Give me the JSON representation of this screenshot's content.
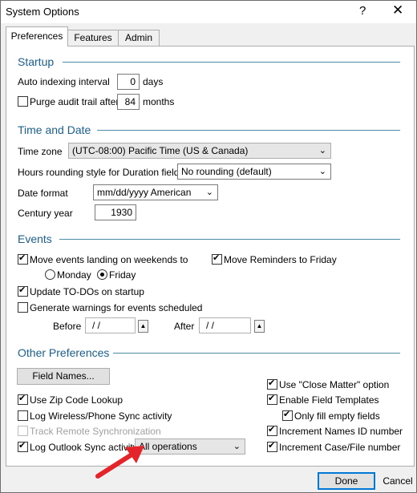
{
  "window": {
    "title": "System Options",
    "help_glyph": "?",
    "close_glyph": "✕"
  },
  "tabs": [
    {
      "label": "Preferences",
      "active": true
    },
    {
      "label": "Features",
      "active": false
    },
    {
      "label": "Admin",
      "active": false
    }
  ],
  "startup": {
    "title": "Startup",
    "auto_index_label": "Auto indexing interval",
    "auto_index_value": "0",
    "auto_index_unit": "days",
    "purge_label": "Purge audit trail after",
    "purge_checked": false,
    "purge_value": "84",
    "purge_unit": "months"
  },
  "time_date": {
    "title": "Time and Date",
    "timezone_label": "Time zone",
    "timezone_value": "(UTC-08:00) Pacific Time (US & Canada)",
    "rounding_label": "Hours rounding style for Duration fields",
    "rounding_value": "No rounding (default)",
    "date_format_label": "Date format",
    "date_format_value": "mm/dd/yyyy  American",
    "century_label": "Century year",
    "century_value": "1930"
  },
  "events": {
    "title": "Events",
    "weekend_label": "Move events landing on weekends to",
    "weekend_checked": true,
    "monday_label": "Monday",
    "friday_label": "Friday",
    "selected_day": "Friday",
    "reminders_label": "Move Reminders to Friday",
    "reminders_checked": true,
    "todos_label": "Update TO-DOs on startup",
    "todos_checked": true,
    "warnings_label": "Generate warnings for events scheduled",
    "warnings_checked": false,
    "before_label": "Before",
    "before_value": "/ /",
    "after_label": "After",
    "after_value": "/ /"
  },
  "other": {
    "title": "Other Preferences",
    "field_names_button": "Field Names...",
    "zip_label": "Use Zip Code Lookup",
    "zip_checked": true,
    "wireless_label": "Log Wireless/Phone Sync activity",
    "wireless_checked": false,
    "remote_label": "Track Remote Synchronization",
    "remote_checked": false,
    "outlook_label": "Log Outlook Sync activity",
    "outlook_checked": true,
    "outlook_value": "All operations",
    "close_matter_label": "Use \"Close Matter\" option",
    "close_matter_checked": true,
    "templates_label": "Enable Field Templates",
    "templates_checked": true,
    "empty_fields_label": "Only fill empty fields",
    "empty_fields_checked": true,
    "names_id_label": "Increment Names ID number",
    "names_id_checked": true,
    "case_file_label": "Increment Case/File number",
    "case_file_checked": true
  },
  "footer": {
    "done_label": "Done",
    "cancel_label": "Cancel"
  },
  "colors": {
    "accent": "#1a5f8e",
    "section_line": "#4a8ea6",
    "arrow": "#e3252b",
    "default_button": "#0078d7"
  }
}
